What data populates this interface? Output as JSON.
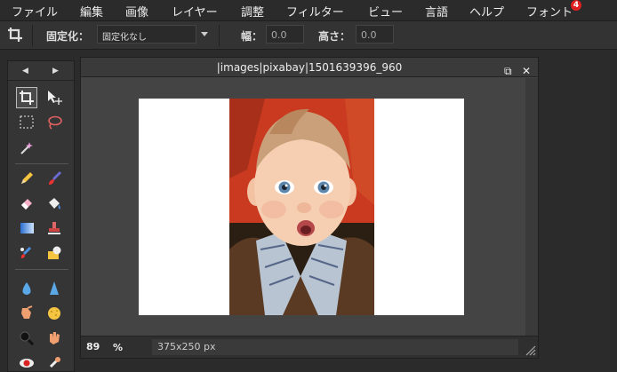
{
  "menu": {
    "items": [
      "ファイル",
      "編集",
      "画像",
      "レイヤー",
      "調整",
      "フィルター",
      "ビュー",
      "言語",
      "ヘルプ",
      "フォント"
    ],
    "font_badge": "4"
  },
  "options": {
    "fixed_label": "固定化：",
    "fixed_value": "固定化なし",
    "width_label": "幅：",
    "width_value": "0.0",
    "height_label": "高さ：",
    "height_value": "0.0"
  },
  "toolbox": {
    "prev_arrow": "◀",
    "next_arrow": "▶"
  },
  "document": {
    "title": "|images|pixabay|1501639396_960",
    "restore_glyph": "⧉",
    "close_glyph": "✕",
    "zoom": "89",
    "zoom_unit": "%",
    "size": "375x250 px"
  },
  "colors": {
    "accent_badge": "#e02020",
    "canvas_bg": "#ffffff",
    "photo_bg": "#c93a20"
  },
  "icons": [
    "crop-icon",
    "move-icon",
    "marquee-icon",
    "lasso-icon",
    "magic-wand-icon",
    "pencil-icon",
    "brush-icon",
    "eraser-icon",
    "bucket-icon",
    "gradient-icon",
    "stamp-icon",
    "color-replace-icon",
    "shape-icon",
    "blur-icon",
    "sharpen-icon",
    "smudge-icon",
    "sponge-icon",
    "zoom-icon",
    "hand-icon",
    "red-eye-icon"
  ]
}
